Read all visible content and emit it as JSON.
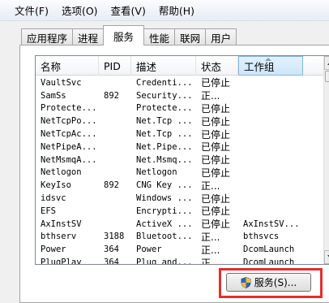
{
  "menu": [
    "文件(F)",
    "选项(O)",
    "查看(V)",
    "帮助(H)"
  ],
  "tabs": [
    {
      "label": "应用程序",
      "active": false
    },
    {
      "label": "进程",
      "active": false
    },
    {
      "label": "服务",
      "active": true
    },
    {
      "label": "性能",
      "active": false
    },
    {
      "label": "联网",
      "active": false
    },
    {
      "label": "用户",
      "active": false
    }
  ],
  "columns": {
    "name": "名称",
    "pid": "PID",
    "desc": "描述",
    "status": "状态",
    "group": "工作组"
  },
  "rows": [
    {
      "name": "VaultSvc",
      "pid": "",
      "desc": "Credenti...",
      "status": "已停止",
      "group": ""
    },
    {
      "name": "SamSs",
      "pid": "892",
      "desc": "Security...",
      "status": "正...",
      "group": ""
    },
    {
      "name": "Protecte...",
      "pid": "",
      "desc": "Protecte...",
      "status": "已停止",
      "group": ""
    },
    {
      "name": "NetTcpPo...",
      "pid": "",
      "desc": "Net.Tcp ...",
      "status": "已停止",
      "group": ""
    },
    {
      "name": "NetTcpAc...",
      "pid": "",
      "desc": "Net.Tcp ...",
      "status": "已停止",
      "group": ""
    },
    {
      "name": "NetPipeA...",
      "pid": "",
      "desc": "Net.Pipe...",
      "status": "已停止",
      "group": ""
    },
    {
      "name": "NetMsmqA...",
      "pid": "",
      "desc": "Net.Msmq...",
      "status": "已停止",
      "group": ""
    },
    {
      "name": "Netlogon",
      "pid": "",
      "desc": "Netlogon",
      "status": "已停止",
      "group": ""
    },
    {
      "name": "KeyIso",
      "pid": "892",
      "desc": "CNG Key ...",
      "status": "正...",
      "group": ""
    },
    {
      "name": "idsvc",
      "pid": "",
      "desc": "Windows ...",
      "status": "已停止",
      "group": ""
    },
    {
      "name": "EFS",
      "pid": "",
      "desc": "Encrypti...",
      "status": "已停止",
      "group": ""
    },
    {
      "name": "AxInstSV",
      "pid": "",
      "desc": "ActiveX ...",
      "status": "已停止",
      "group": "AxInstSV..."
    },
    {
      "name": "bthserv",
      "pid": "3188",
      "desc": "Bluetoot...",
      "status": "正...",
      "group": "bthsvcs"
    },
    {
      "name": "Power",
      "pid": "364",
      "desc": "Power",
      "status": "正...",
      "group": "DcomLaunch"
    },
    {
      "name": "PlugPlay",
      "pid": "364",
      "desc": "Plug and...",
      "status": "正...",
      "group": "DcomLaunch"
    }
  ],
  "services_button": "服务(S)..."
}
